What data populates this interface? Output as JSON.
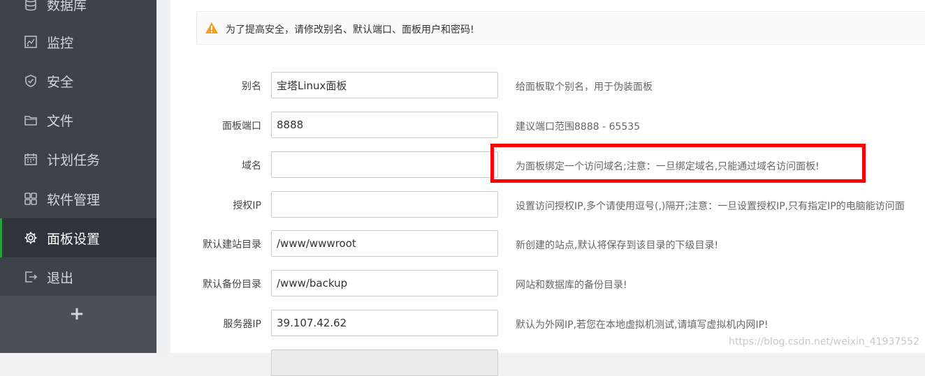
{
  "sidebar": {
    "items": [
      {
        "label": "数据库",
        "icon": "database-icon"
      },
      {
        "label": "监控",
        "icon": "monitor-icon"
      },
      {
        "label": "安全",
        "icon": "shield-icon"
      },
      {
        "label": "文件",
        "icon": "folder-icon"
      },
      {
        "label": "计划任务",
        "icon": "calendar-icon"
      },
      {
        "label": "软件管理",
        "icon": "grid-icon"
      },
      {
        "label": "面板设置",
        "icon": "gear-icon",
        "active": true
      },
      {
        "label": "退出",
        "icon": "logout-icon"
      }
    ],
    "add_label": "+"
  },
  "alert": {
    "text": "为了提高安全，请修改别名、默认端口、面板用户和密码!",
    "icon": "warning-icon"
  },
  "form": {
    "alias": {
      "label": "别名",
      "value": "宝塔Linux面板",
      "hint": "给面板取个别名，用于伪装面板"
    },
    "port": {
      "label": "面板端口",
      "value": "8888",
      "hint": "建议端口范围8888 - 65535"
    },
    "domain": {
      "label": "域名",
      "value": "",
      "hint": "为面板绑定一个访问域名;注意：一旦绑定域名,只能通过域名访问面板!"
    },
    "auth_ip": {
      "label": "授权IP",
      "value": "",
      "hint": "设置访问授权IP,多个请使用逗号(,)隔开;注意：一旦设置授权IP,只有指定IP的电脑能访问面"
    },
    "site_dir": {
      "label": "默认建站目录",
      "value": "/www/wwwroot",
      "hint": "新创建的站点,默认将保存到该目录的下级目录!"
    },
    "backup_dir": {
      "label": "默认备份目录",
      "value": "/www/backup",
      "hint": "网站和数据库的备份目录!"
    },
    "server_ip": {
      "label": "服务器IP",
      "value": "39.107.42.62",
      "hint": "默认为外网IP,若您在本地虚拟机测试,请填写虚拟机内网IP!"
    }
  },
  "colors": {
    "accent": "#20a53a",
    "highlight": "#ff0000",
    "warning": "#f0a020"
  },
  "watermark": "https://blog.csdn.net/weixin_41937552"
}
